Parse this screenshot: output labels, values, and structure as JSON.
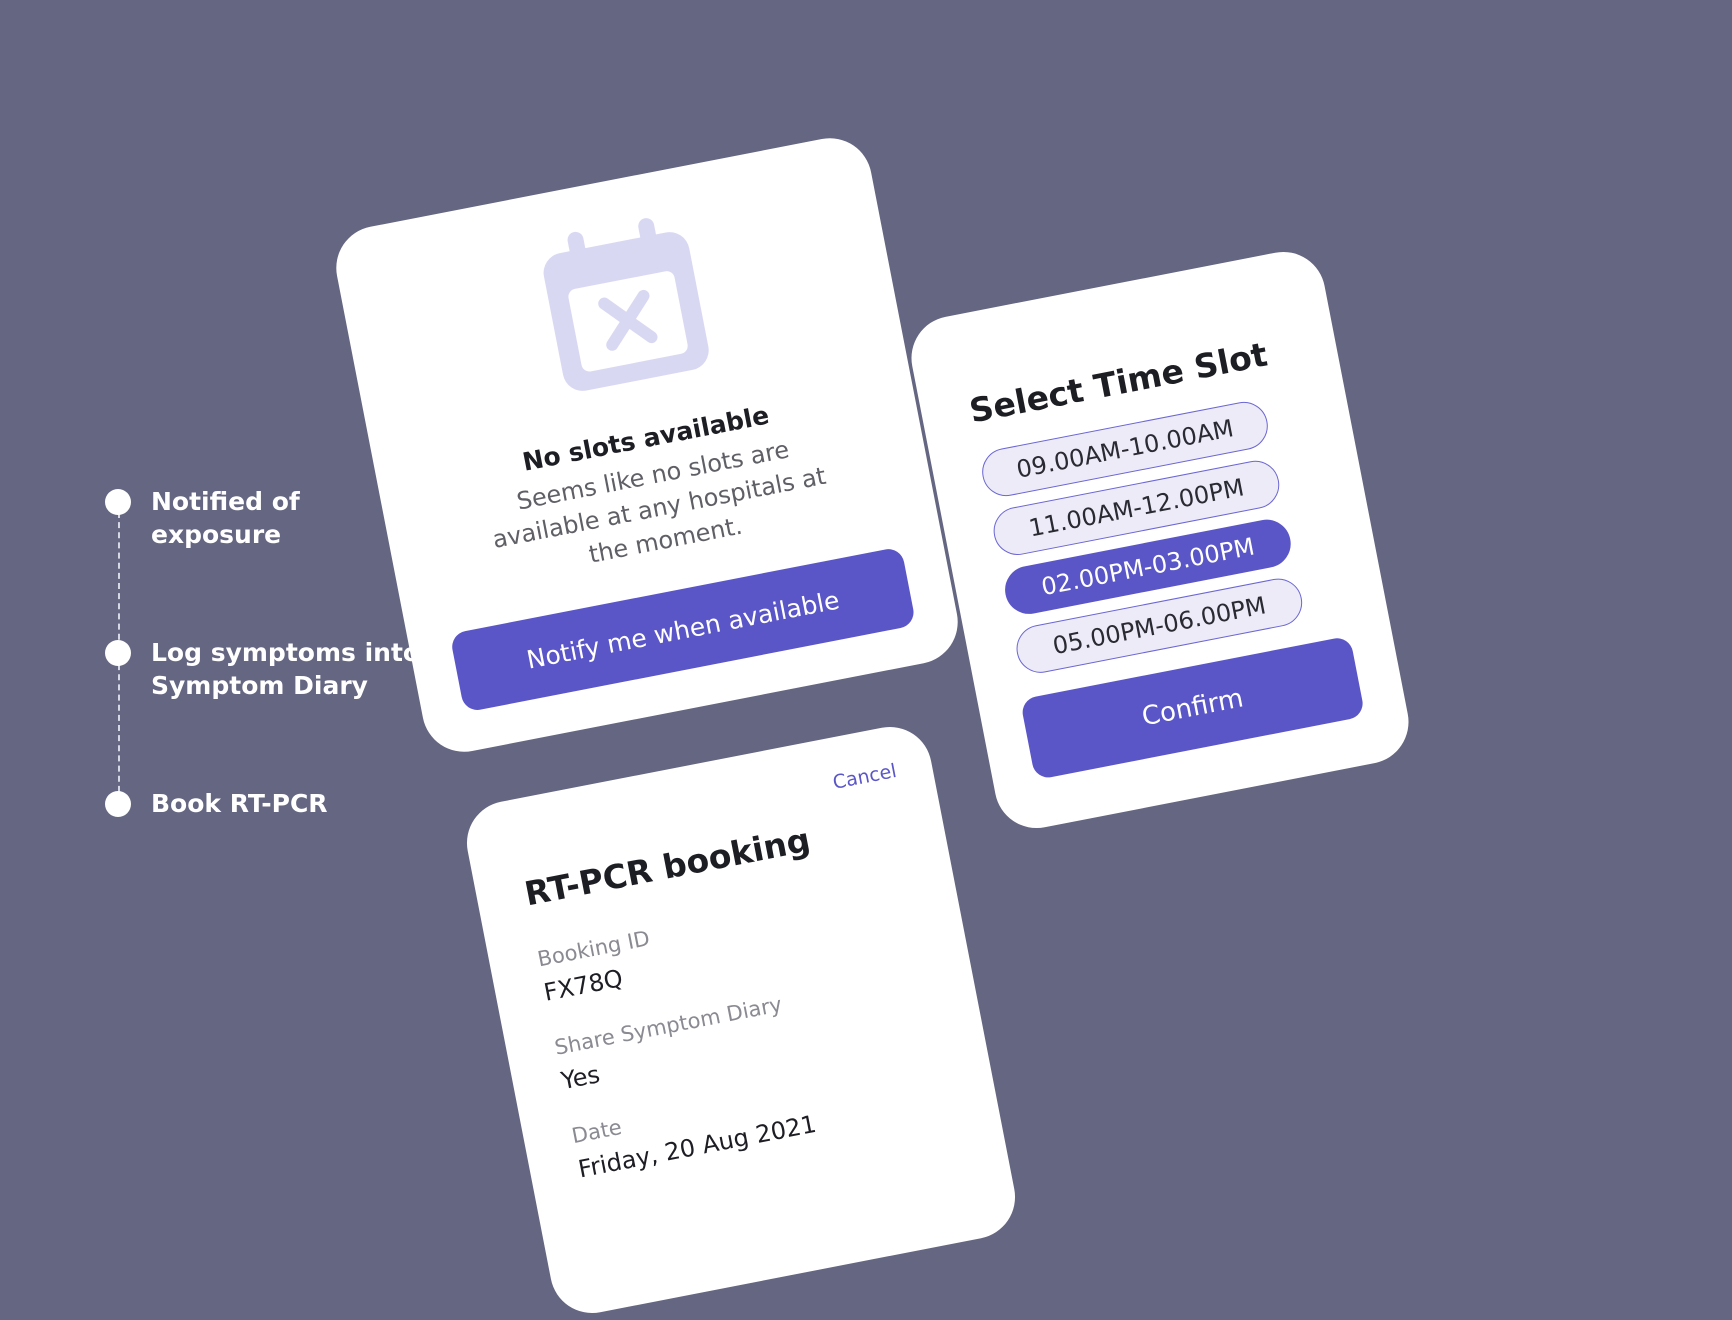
{
  "timeline": {
    "steps": [
      {
        "label": "Notified of\nexposure"
      },
      {
        "label": "Log symptoms into\nSymptom Diary"
      },
      {
        "label": "Book RT-PCR"
      }
    ]
  },
  "no_slots_card": {
    "icon": "calendar-x-icon",
    "title": "No slots available",
    "message": "Seems like no slots are available at any hospitals at the moment.",
    "button": "Notify me when available"
  },
  "time_slot_card": {
    "title": "Select Time Slot",
    "slots": [
      {
        "label": "09.00AM-10.00AM",
        "selected": false
      },
      {
        "label": "11.00AM-12.00PM",
        "selected": false
      },
      {
        "label": "02.00PM-03.00PM",
        "selected": true
      },
      {
        "label": "05.00PM-06.00PM",
        "selected": false
      }
    ],
    "confirm": "Confirm"
  },
  "booking_card": {
    "title": "RT-PCR booking",
    "cancel": "Cancel",
    "fields": [
      {
        "label": "Booking ID",
        "value": "FX78Q"
      },
      {
        "label": "Share Symptom Diary",
        "value": "Yes"
      },
      {
        "label": "Date",
        "value": "Friday, 20 Aug 2021"
      }
    ]
  },
  "colors": {
    "background": "#646682",
    "accent": "#5b56c8",
    "slot_bg": "#ecebf7",
    "icon": "#d9d8f3"
  }
}
